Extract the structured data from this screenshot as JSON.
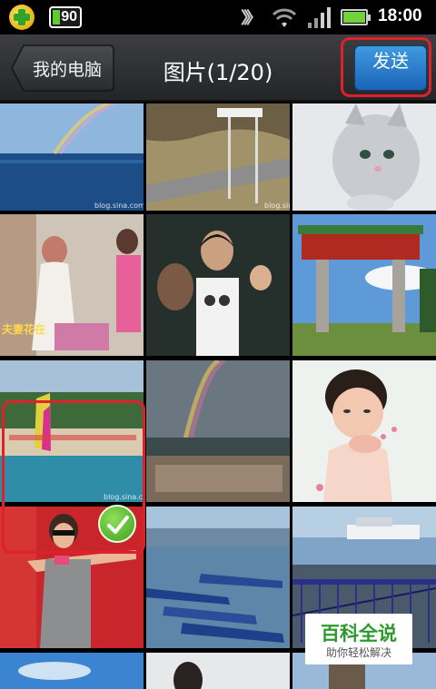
{
  "status_bar": {
    "notification_badge": "90",
    "time": "18:00",
    "icons": [
      "360-security-icon",
      "battery-saver-icon",
      "data-sync-icon",
      "wifi-icon",
      "signal-icon",
      "battery-icon"
    ]
  },
  "action_bar": {
    "back_label": "我的电脑",
    "title": "图片(1/20)",
    "send_label": "发送"
  },
  "gallery": {
    "watermark": "blog.sina.com",
    "photo_caption": "夫妻花在",
    "selected_index": 9,
    "items": [
      "rainbow-over-sea",
      "road-sign-landscape",
      "white-kitten",
      "women-shopping",
      "child-waving-at-window",
      "ornamental-gate",
      "beach-crowd",
      "rainbow-over-town",
      "girl-blowing-petals",
      "woman-taking-photo",
      "boats-on-lake",
      "pier-with-ferry"
    ]
  },
  "colors": {
    "highlight_red": "#e0202a",
    "send_blue": "#2a7fd0",
    "check_green": "#5cc02c",
    "watermark_green": "#2c9a2c"
  },
  "overlay_watermark": {
    "title": "百科全说",
    "subtitle": "助你轻松解决"
  }
}
